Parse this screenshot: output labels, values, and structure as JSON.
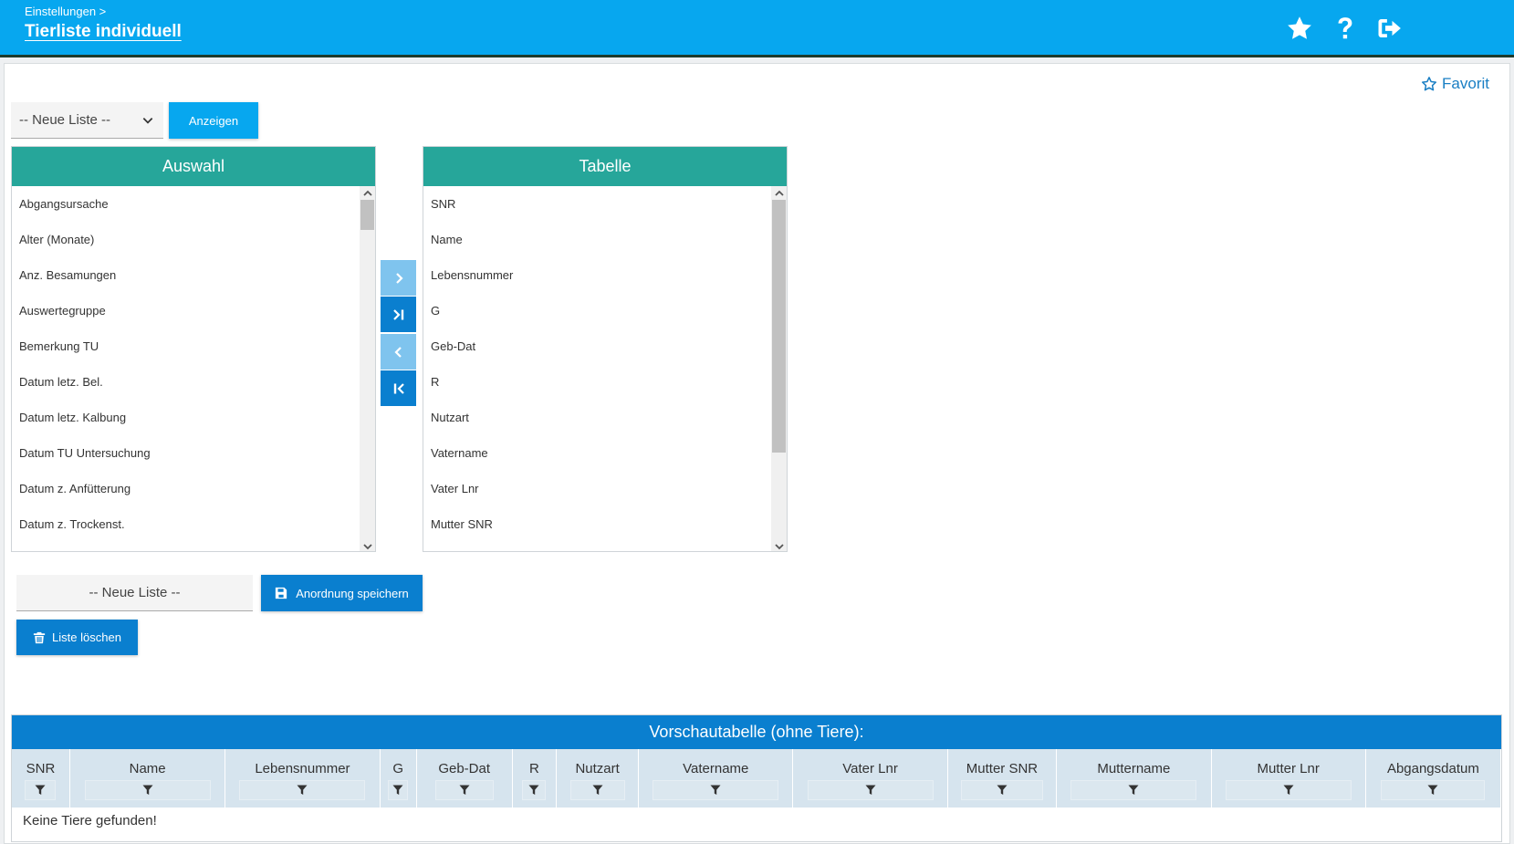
{
  "header": {
    "breadcrumb": "Einstellungen >",
    "title": "Tierliste individuell",
    "icons": [
      "star-icon",
      "help-icon",
      "logout-icon"
    ]
  },
  "favorite": {
    "label": "Favorit"
  },
  "list_select": {
    "value": "-- Neue Liste --"
  },
  "show_button": {
    "label": "Anzeigen"
  },
  "available": {
    "title": "Auswahl",
    "items": [
      "Abgangsursache",
      "Alter (Monate)",
      "Anz. Besamungen",
      "Auswertegruppe",
      "Bemerkung TU",
      "Datum letz. Bel.",
      "Datum letz. Kalbung",
      "Datum TU Untersuchung",
      "Datum z. Anfütterung",
      "Datum z. Trockenst."
    ]
  },
  "selected": {
    "title": "Tabelle",
    "items": [
      "SNR",
      "Name",
      "Lebensnummer",
      "G",
      "Geb-Dat",
      "R",
      "Nutzart",
      "Vatername",
      "Vater Lnr",
      "Mutter SNR"
    ]
  },
  "list_name": {
    "value": "-- Neue Liste --"
  },
  "save_button": {
    "label": "Anordnung speichern"
  },
  "delete_button": {
    "label": "Liste löschen"
  },
  "preview": {
    "title": "Vorschautabelle (ohne Tiere):",
    "columns": [
      "SNR",
      "Name",
      "Lebensnummer",
      "G",
      "Geb-Dat",
      "R",
      "Nutzart",
      "Vatername",
      "Vater Lnr",
      "Mutter SNR",
      "Muttername",
      "Mutter Lnr",
      "Abgangsdatum"
    ],
    "empty_text": "Keine Tiere gefunden!"
  },
  "colors": {
    "header": "#07a7ef",
    "list_header": "#26a69a",
    "button_dark": "#0a7fcf",
    "button_light": "#7fc4ee"
  }
}
